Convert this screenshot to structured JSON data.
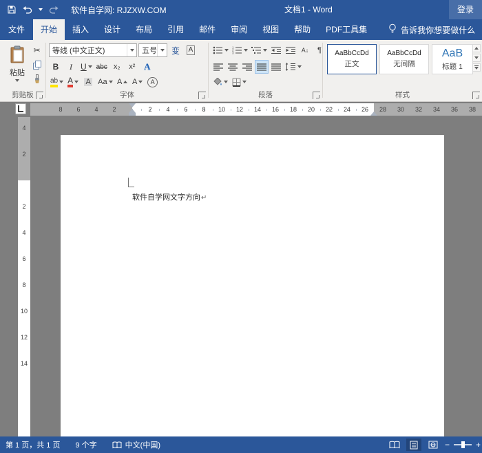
{
  "title_bar": {
    "doc_label": "软件自学网: RJZXW.COM",
    "window_title": "文档1 - Word",
    "sign_in": "登录"
  },
  "tabs": {
    "file": "文件",
    "active_index": 0,
    "items": [
      "开始",
      "插入",
      "设计",
      "布局",
      "引用",
      "邮件",
      "审阅",
      "视图",
      "帮助",
      "PDF工具集"
    ],
    "tell_me": "告诉我你想要做什么"
  },
  "ribbon": {
    "clipboard": {
      "label": "剪贴板",
      "paste": "粘贴"
    },
    "font": {
      "label": "字体",
      "name": "等线 (中文正文)",
      "size": "五号",
      "bold": "B",
      "italic": "I",
      "underline": "U",
      "strike": "abc",
      "subscript": "x₂",
      "superscript": "x²",
      "effects": "A",
      "phonetic": "变",
      "char_border": "A",
      "highlight": "ab",
      "color": "A",
      "shading": "A",
      "case": "Aa",
      "grow": "A",
      "shrink": "A",
      "enclose": "A"
    },
    "paragraph": {
      "label": "段落",
      "sort": "A↓",
      "pilcrow": "¶"
    },
    "styles": {
      "label": "样式",
      "items": [
        {
          "preview": "AaBbCcDd",
          "name": "正文"
        },
        {
          "preview": "AaBbCcDd",
          "name": "无间隔"
        },
        {
          "preview": "AaB",
          "name": "标题 1"
        }
      ]
    }
  },
  "ruler": {
    "h_margin_numbers": [
      "8",
      "6",
      "4",
      "2"
    ],
    "h_numbers": [
      "2",
      "4",
      "6",
      "8",
      "10",
      "12",
      "14",
      "16",
      "18",
      "20",
      "22",
      "24",
      "26",
      "28",
      "30",
      "32",
      "34",
      "36",
      "38"
    ],
    "v_margin_numbers": [
      "4",
      "2"
    ],
    "v_numbers": [
      "2",
      "4",
      "6",
      "8",
      "10",
      "12",
      "14"
    ]
  },
  "document": {
    "text": "软件自学网文字方向",
    "paragraph_mark": "↵"
  },
  "status_bar": {
    "page_info": "第 1 页，共 1 页",
    "word_count": "9 个字",
    "language": "中文(中国)",
    "zoom_out": "−",
    "zoom_in": "+"
  },
  "icons": {
    "scissors": "✂"
  },
  "colors": {
    "titlebar": "#2b579a",
    "ribbon_bg": "#f1f0ee",
    "heading_preview": "#2e74b5",
    "highlight_yellow": "#ffe400",
    "font_color_red": "#e03c31"
  }
}
